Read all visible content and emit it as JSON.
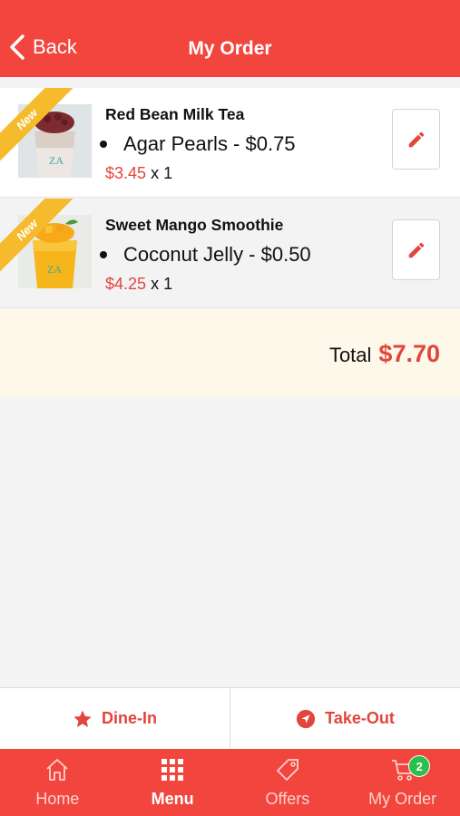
{
  "header": {
    "back_label": "Back",
    "title": "My Order"
  },
  "items": [
    {
      "badge": "New",
      "name": "Red Bean Milk Tea",
      "addon": "Agar Pearls - $0.75",
      "price": "$3.45",
      "qty": "x 1"
    },
    {
      "badge": "New",
      "name": "Sweet Mango Smoothie",
      "addon": "Coconut Jelly - $0.50",
      "price": "$4.25",
      "qty": "x 1"
    }
  ],
  "total": {
    "label": "Total",
    "amount": "$7.70"
  },
  "order_type": {
    "dine_in": "Dine-In",
    "take_out": "Take-Out"
  },
  "tabs": [
    {
      "label": "Home",
      "icon": "home-icon"
    },
    {
      "label": "Menu",
      "icon": "grid-icon"
    },
    {
      "label": "Offers",
      "icon": "tag-icon"
    },
    {
      "label": "My Order",
      "icon": "cart-icon",
      "badge": "2"
    }
  ],
  "colors": {
    "accent": "#f2453d",
    "price": "#e2453c",
    "ribbon": "#f6bb2c",
    "badge": "#2bbf4c"
  }
}
